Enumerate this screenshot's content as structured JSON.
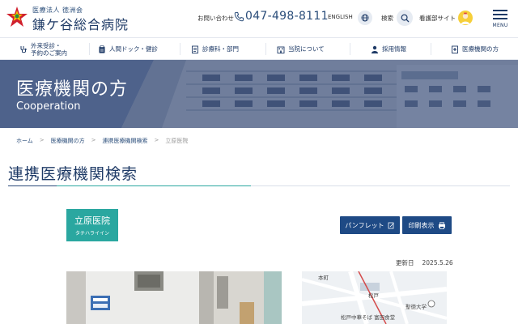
{
  "header": {
    "corp_name": "医療法人 徳洲会",
    "hospital_name": "鎌ケ谷総合病院",
    "contact_label": "お問い合わせ",
    "phone": "047-498-8111",
    "english_label": "ENGLISH",
    "search_label": "検索",
    "nurse_site_label": "看護部サイト",
    "menu_label": "MENU"
  },
  "nav": {
    "items": [
      {
        "label_line1": "外来受診・",
        "label_line2": "予約のご案内",
        "icon": "stethoscope-icon"
      },
      {
        "label": "人間ドック・健診",
        "icon": "clipboard-icon"
      },
      {
        "label": "診療科・部門",
        "icon": "document-icon"
      },
      {
        "label": "当院について",
        "icon": "building-icon"
      },
      {
        "label": "採用情報",
        "icon": "person-icon"
      },
      {
        "label": "医療機関の方",
        "icon": "hospital-file-icon"
      }
    ]
  },
  "banner": {
    "title": "医療機関の方",
    "subtitle": "Cooperation"
  },
  "breadcrumb": {
    "items": [
      "ホーム",
      "医療機関の方",
      "連携医療機関検索"
    ],
    "current": "立原医院",
    "separator": ">"
  },
  "page": {
    "title": "連携医療機関検索"
  },
  "facility": {
    "name": "立原医院",
    "kana": "タチハライイン",
    "pamphlet_label": "パンフレット",
    "print_label": "印刷表示",
    "updated_label": "更新日",
    "updated_date": "2025.5.26"
  },
  "map": {
    "labels": [
      "本町",
      "松戸",
      "聖徳大学",
      "松戸中華そば 富田食堂"
    ]
  },
  "colors": {
    "navy": "#1e4a85",
    "teal": "#2aa7a0",
    "text": "#1e3a66"
  }
}
